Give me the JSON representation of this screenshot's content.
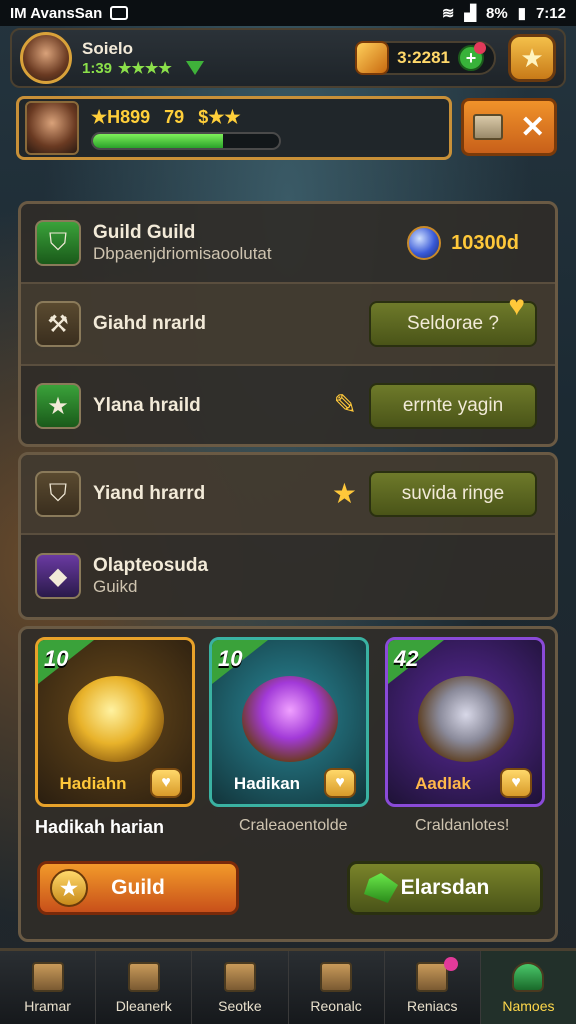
{
  "status_bar": {
    "left_text": "IM AvansSan",
    "time": "7:12",
    "battery": "8%"
  },
  "player": {
    "name": "Soielo",
    "stat": "1:39",
    "stars": "★★★★"
  },
  "currency": {
    "value": "3:2281",
    "plus": "+"
  },
  "xp": {
    "left": "★H899",
    "mid": "79",
    "right": "$★★",
    "fill_percent": 70
  },
  "guild_panel": {
    "title": "Guild Guild",
    "subtitle": "Dbpaenjdriomisaoolutat",
    "coins": "10300d",
    "rows": [
      {
        "label": "Giahd nrarld",
        "button": "Seldorae ?"
      },
      {
        "label": "Ylana hraild",
        "button": "errnte yagin"
      }
    ]
  },
  "guild_panel2": {
    "rows": [
      {
        "label": "Yiand hrarrd",
        "button": "suvida ringe"
      },
      {
        "label": "Olapteosuda",
        "sub": "Guikd"
      }
    ]
  },
  "cards": [
    {
      "num": "10",
      "name": "Hadiahn",
      "caption": "Hadikah harian",
      "accent": "#e8a22a"
    },
    {
      "num": "10",
      "name": "Hadikan",
      "caption": "Craleaoentolde",
      "accent": "#3ab2a2"
    },
    {
      "num": "42",
      "name": "Aadlak",
      "caption": "Craldanlotes!",
      "accent": "#8a4ad8"
    }
  ],
  "buttons": {
    "guild": "Guild",
    "elarsdan": "Elarsdan"
  },
  "nav": [
    "Hramar",
    "Dleanerk",
    "Seotke",
    "Reonalc",
    "Reniacs",
    "Namoes"
  ]
}
